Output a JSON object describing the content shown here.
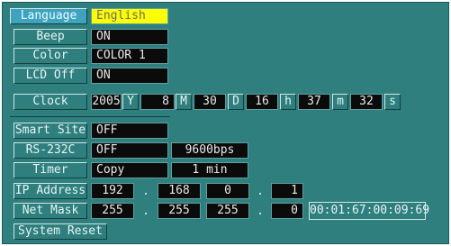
{
  "rows": {
    "language": {
      "label": "Language",
      "value": "English"
    },
    "beep": {
      "label": "Beep",
      "value": "ON"
    },
    "color": {
      "label": "Color",
      "value": "COLOR 1"
    },
    "lcd_off": {
      "label": "LCD Off",
      "value": "ON"
    },
    "clock": {
      "label": "Clock",
      "year": "2005",
      "year_unit": "Y",
      "month": "8",
      "month_unit": "M",
      "day": "30",
      "day_unit": "D",
      "hour": "16",
      "hour_unit": "h",
      "minute": "37",
      "minute_unit": "m",
      "second": "32",
      "second_unit": "s"
    },
    "smart_site": {
      "label": "Smart Site",
      "value": "OFF"
    },
    "rs232c": {
      "label": "RS-232C",
      "value": "OFF",
      "baud": "9600bps"
    },
    "timer": {
      "label": "Timer",
      "value": "Copy",
      "interval": "1 min"
    },
    "ip_address": {
      "label": "IP Address",
      "octets": [
        "192",
        "168",
        "0",
        "1"
      ],
      "dot": "."
    },
    "net_mask": {
      "label": "Net Mask",
      "octets": [
        "255",
        "255",
        "255",
        "0"
      ],
      "dot": ".",
      "mac": "00:01:67:00:09:69"
    },
    "system_reset": {
      "label": "System Reset"
    }
  },
  "colors": {
    "background": "#2f7f7f",
    "value_box": "#0b0b0b",
    "highlight": "#ffff00",
    "active_label": "#3fa3c0"
  }
}
